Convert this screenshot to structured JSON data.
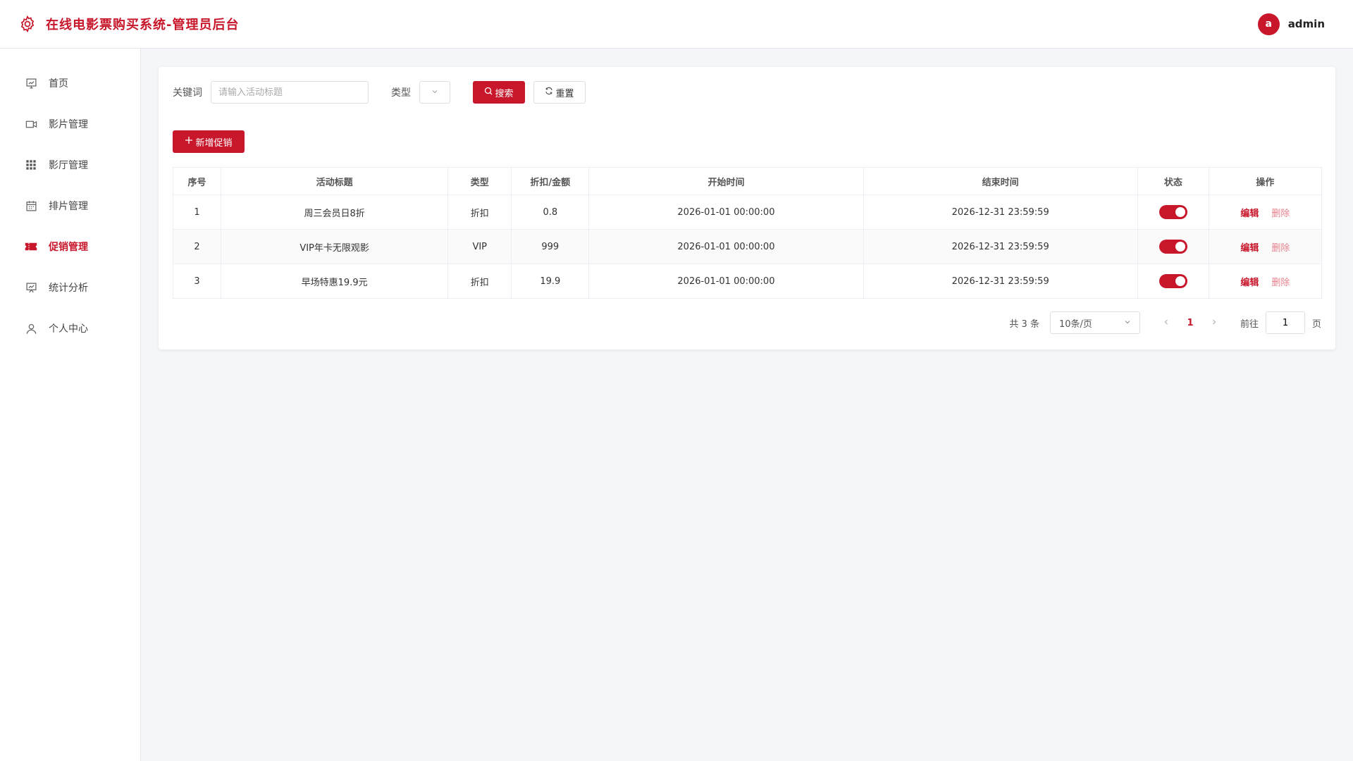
{
  "header": {
    "title": "在线电影票购买系统-管理员后台",
    "avatar_letter": "a",
    "username": "admin"
  },
  "sidebar": {
    "items": [
      {
        "label": "首页",
        "icon": "monitor-chart-icon"
      },
      {
        "label": "影片管理",
        "icon": "video-camera-icon"
      },
      {
        "label": "影厅管理",
        "icon": "grid-icon"
      },
      {
        "label": "排片管理",
        "icon": "calendar-icon"
      },
      {
        "label": "促销管理",
        "icon": "ticket-icon",
        "active": true
      },
      {
        "label": "统计分析",
        "icon": "presentation-icon"
      },
      {
        "label": "个人中心",
        "icon": "user-icon"
      }
    ]
  },
  "search": {
    "keyword_label": "关键词",
    "keyword_placeholder": "请输入活动标题",
    "keyword_value": "",
    "type_label": "类型",
    "search_button": "搜索",
    "reset_button": "重置"
  },
  "actions": {
    "add_button": "新增促销"
  },
  "table": {
    "columns": [
      "序号",
      "活动标题",
      "类型",
      "折扣/金额",
      "开始时间",
      "结束时间",
      "状态",
      "操作"
    ],
    "rows": [
      {
        "index": "1",
        "title": "周三会员日8折",
        "type": "折扣",
        "amount": "0.8",
        "start": "2026-01-01 00:00:00",
        "end": "2026-12-31 23:59:59",
        "enabled": true
      },
      {
        "index": "2",
        "title": "VIP年卡无限观影",
        "type": "VIP",
        "amount": "999",
        "start": "2026-01-01 00:00:00",
        "end": "2026-12-31 23:59:59",
        "enabled": true
      },
      {
        "index": "3",
        "title": "早场特惠19.9元",
        "type": "折扣",
        "amount": "19.9",
        "start": "2026-01-01 00:00:00",
        "end": "2026-12-31 23:59:59",
        "enabled": true
      }
    ],
    "edit_label": "编辑",
    "delete_label": "删除"
  },
  "pagination": {
    "total_text": "共 3 条",
    "page_size": "10条/页",
    "current_page": "1",
    "goto_label": "前往",
    "goto_value": "1",
    "page_suffix": "页"
  },
  "colors": {
    "accent": "#c8162b"
  }
}
